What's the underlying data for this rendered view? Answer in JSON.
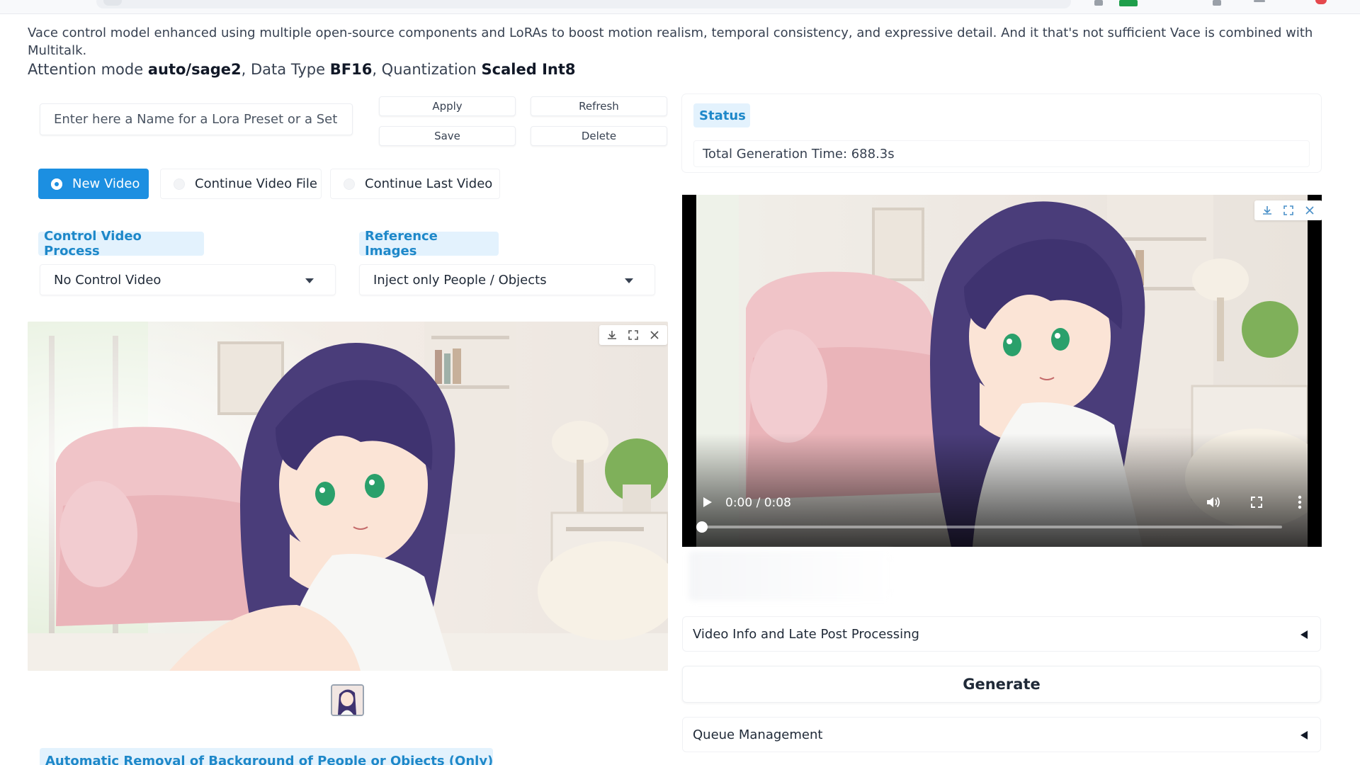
{
  "description": "Vace control model enhanced using multiple open-source components and LoRAs to boost motion realism, temporal consistency, and expressive detail. And it that's not sufficient Vace is combined with Multitalk.",
  "attention": {
    "prefix1": "Attention mode ",
    "mode": "auto/sage2",
    "prefix2": ", Data Type ",
    "dtype": "BF16",
    "prefix3": ", Quantization ",
    "quant": "Scaled Int8"
  },
  "preset": {
    "placeholder": "Enter here a Name for a Lora Preset or a Set",
    "apply": "Apply",
    "refresh": "Refresh",
    "save": "Save",
    "delete": "Delete"
  },
  "video_mode": {
    "options": [
      "New Video",
      "Continue Video File",
      "Continue Last Video"
    ],
    "selected": "New Video"
  },
  "control_video": {
    "label": "Control Video Process",
    "value": "No Control Video"
  },
  "reference_images": {
    "label": "Reference Images",
    "value": "Inject only People / Objects"
  },
  "bottom_section_label": "Automatic Removal of Background of People or Objects (Only)",
  "status": {
    "label": "Status",
    "value": "Total Generation Time: 688.3s"
  },
  "video": {
    "time": "0:00 / 0:08",
    "progress": 0.0
  },
  "accordions": {
    "video_info": "Video Info and Late Post Processing",
    "queue": "Queue Management"
  },
  "generate_label": "Generate",
  "colors": {
    "accent": "#1c8fe1",
    "label_bg": "#e3f2fd",
    "label_text": "#1e88c9"
  },
  "icons": [
    "download-icon",
    "fullscreen-icon",
    "close-icon",
    "play-icon",
    "volume-icon",
    "more-vert-icon",
    "dropdown-caret-icon",
    "collapse-triangle-icon"
  ]
}
